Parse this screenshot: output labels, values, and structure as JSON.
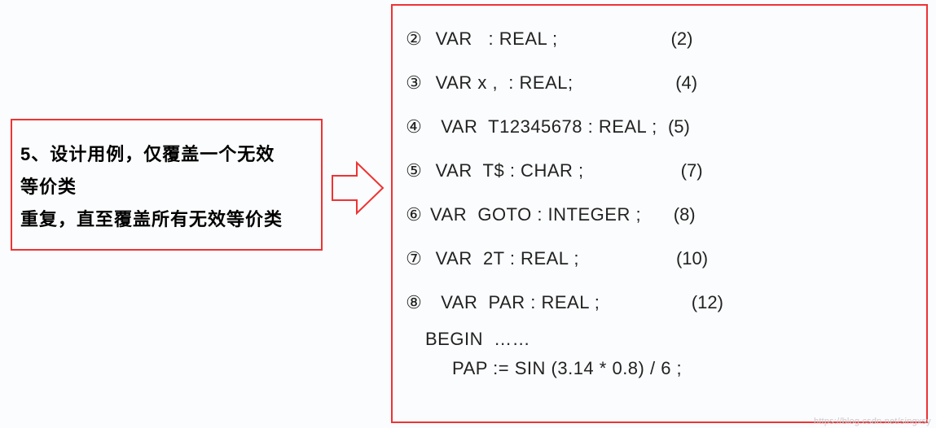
{
  "left": {
    "l1": "5、设计用例，仅覆盖一个无效",
    "l2": "等价类",
    "l3": "重复，直至覆盖所有无效等价类"
  },
  "right": {
    "rows": [
      {
        "marker": "②",
        "code": " VAR   : REAL ;",
        "pad": "                     ",
        "num": "(2)"
      },
      {
        "marker": "③",
        "code": " VAR x ,  : REAL;",
        "pad": "                   ",
        "num": "(4)"
      },
      {
        "marker": "④",
        "code": "  VAR  T12345678 : REAL ;",
        "pad": "  ",
        "num": "(5)"
      },
      {
        "marker": "⑤",
        "code": " VAR  T$ : CHAR ;",
        "pad": "                  ",
        "num": "(7)"
      },
      {
        "marker": "⑥",
        "code": "VAR  GOTO : INTEGER ;",
        "pad": "      ",
        "num": "(8)"
      },
      {
        "marker": "⑦",
        "code": " VAR  2T : REAL ;",
        "pad": "                  ",
        "num": "(10)"
      },
      {
        "marker": "⑧",
        "code": "  VAR  PAR : REAL ;",
        "pad": "                 ",
        "num": "(12)"
      }
    ],
    "extra1": "BEGIN  ……",
    "extra2": "     PAP := SIN (3.14 * 0.8) / 6 ;"
  },
  "watermark": "https://blog.csdn.net/singxsy"
}
